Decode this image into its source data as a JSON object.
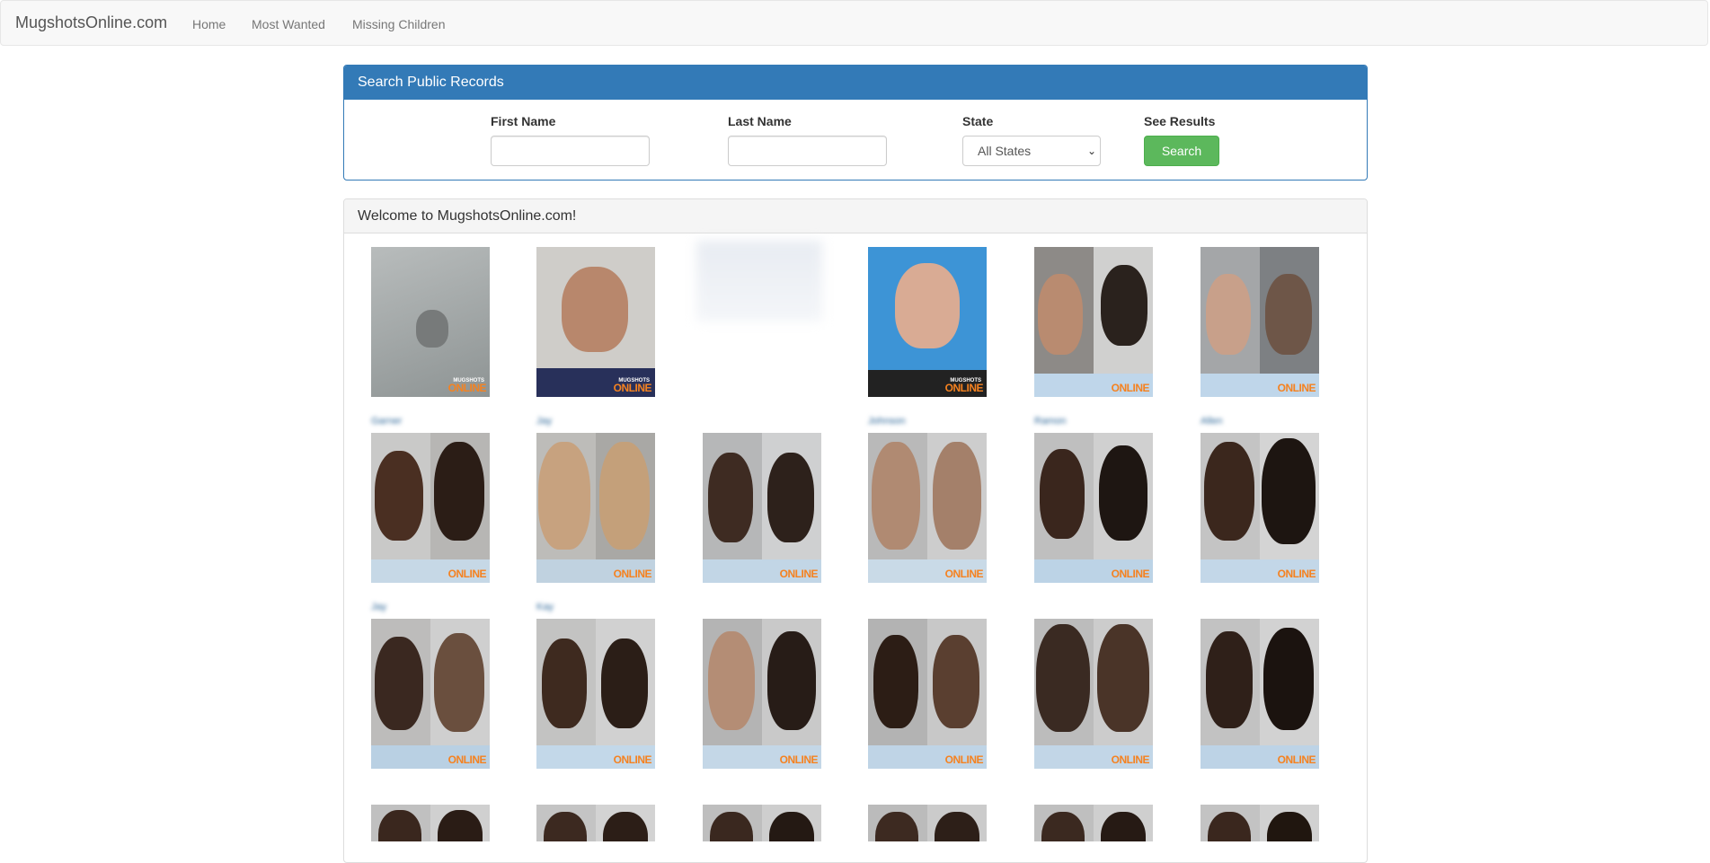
{
  "navbar": {
    "brand": "MugshotsOnline.com",
    "links": [
      "Home",
      "Most Wanted",
      "Missing Children"
    ]
  },
  "search": {
    "title": "Search Public Records",
    "first_name_label": "First Name",
    "last_name_label": "Last Name",
    "state_label": "State",
    "state_selected": "All States",
    "results_label": "See Results",
    "button_label": "Search"
  },
  "main": {
    "title": "Welcome to MugshotsOnline.com!",
    "watermark": "ONLINE",
    "watermark_top": "MUGSHOTS",
    "captions": [
      [
        "Garner",
        "",
        "",
        "Johnson",
        "Ramon",
        "Allen"
      ],
      [
        "Jay",
        "Kay",
        "",
        "",
        "",
        ""
      ],
      [
        "",
        "",
        "",
        "",
        "",
        ""
      ]
    ]
  },
  "colors": {
    "primary": "#337ab7",
    "success": "#5cb85c",
    "watermark": "#f58220"
  }
}
